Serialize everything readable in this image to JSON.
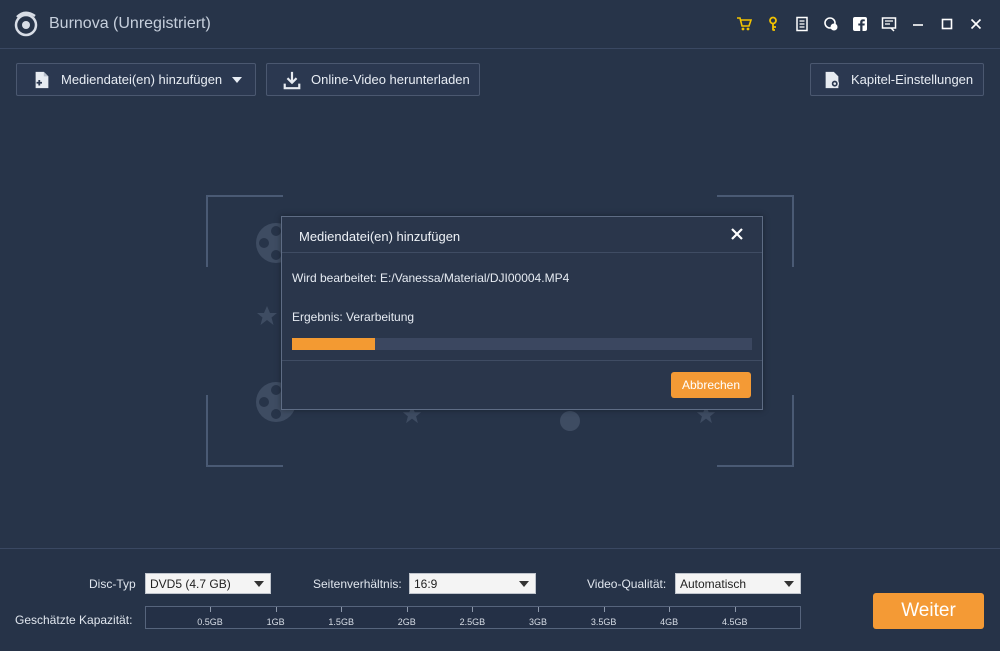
{
  "app": {
    "title": "Burnova (Unregistriert)"
  },
  "titlebar_icons": [
    "cart-icon",
    "key-icon",
    "document-icon",
    "chat-icon",
    "facebook-icon",
    "feedback-icon",
    "minimize-icon",
    "maximize-icon",
    "close-icon"
  ],
  "toolbar": {
    "add_media_label": "Mediendatei(en) hinzufügen",
    "download_label": "Online-Video herunterladen",
    "chapter_label": "Kapitel-Einstellungen"
  },
  "dialog": {
    "title": "Mediendatei(en) hinzufügen",
    "processing_text": "Wird bearbeitet: E:/Vanessa/Material/DJI00004.MP4",
    "result_text": "Ergebnis: Verarbeitung",
    "progress": 0.18,
    "cancel_label": "Abbrechen"
  },
  "bottom": {
    "disc_type_label": "Disc-Typ",
    "disc_type_value": "DVD5 (4.7 GB)",
    "aspect_label": "Seitenverhältnis:",
    "aspect_value": "16:9",
    "quality_label": "Video-Qualität:",
    "quality_value": "Automatisch",
    "capacity_label": "Geschätzte Kapazität:",
    "capacity_ticks": [
      "0.5GB",
      "1GB",
      "1.5GB",
      "2GB",
      "2.5GB",
      "3GB",
      "3.5GB",
      "4GB",
      "4.5GB"
    ],
    "next_label": "Weiter"
  },
  "colors": {
    "background": "#273449",
    "accent": "#f49a35",
    "dialog_bg": "#2a364b"
  }
}
